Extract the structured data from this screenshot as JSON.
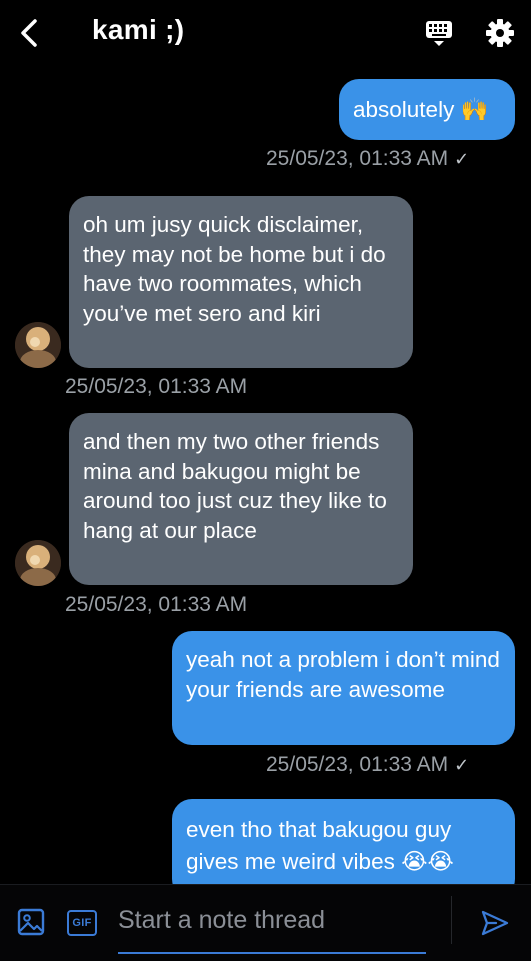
{
  "header": {
    "title": "kami ;)",
    "back_icon": "chevron-left-icon",
    "keyboard_icon": "keyboard-icon",
    "settings_icon": "gear-icon"
  },
  "messages": [
    {
      "direction": "out",
      "text": "absolutely 🙌",
      "timestamp": "25/05/23, 01:33 AM",
      "read": "✓"
    },
    {
      "direction": "in",
      "text": "oh um jusy quick disclaimer, they may not be home but i do have two roommates, which you’ve met sero and kiri",
      "timestamp": "25/05/23, 01:33 AM"
    },
    {
      "direction": "in",
      "text": "and then my two other friends mina and bakugou might be around too just cuz they like to hang at our place",
      "timestamp": "25/05/23, 01:33 AM"
    },
    {
      "direction": "out",
      "text": "yeah not a problem i don’t mind your friends are awesome",
      "timestamp": "25/05/23, 01:33 AM",
      "read": "✓"
    },
    {
      "direction": "out",
      "text": "even tho that bakugou guy gives me weird vibes 😭😭"
    }
  ],
  "composer": {
    "placeholder": "Start a note thread",
    "gif_label": "GIF",
    "image_icon": "image-icon",
    "send_icon": "send-icon"
  },
  "colors": {
    "outgoing_bubble": "#3a92e8",
    "incoming_bubble": "#5b6571",
    "background": "#000000",
    "timestamp": "#9aa0a6",
    "accent": "#3b7bd6"
  }
}
